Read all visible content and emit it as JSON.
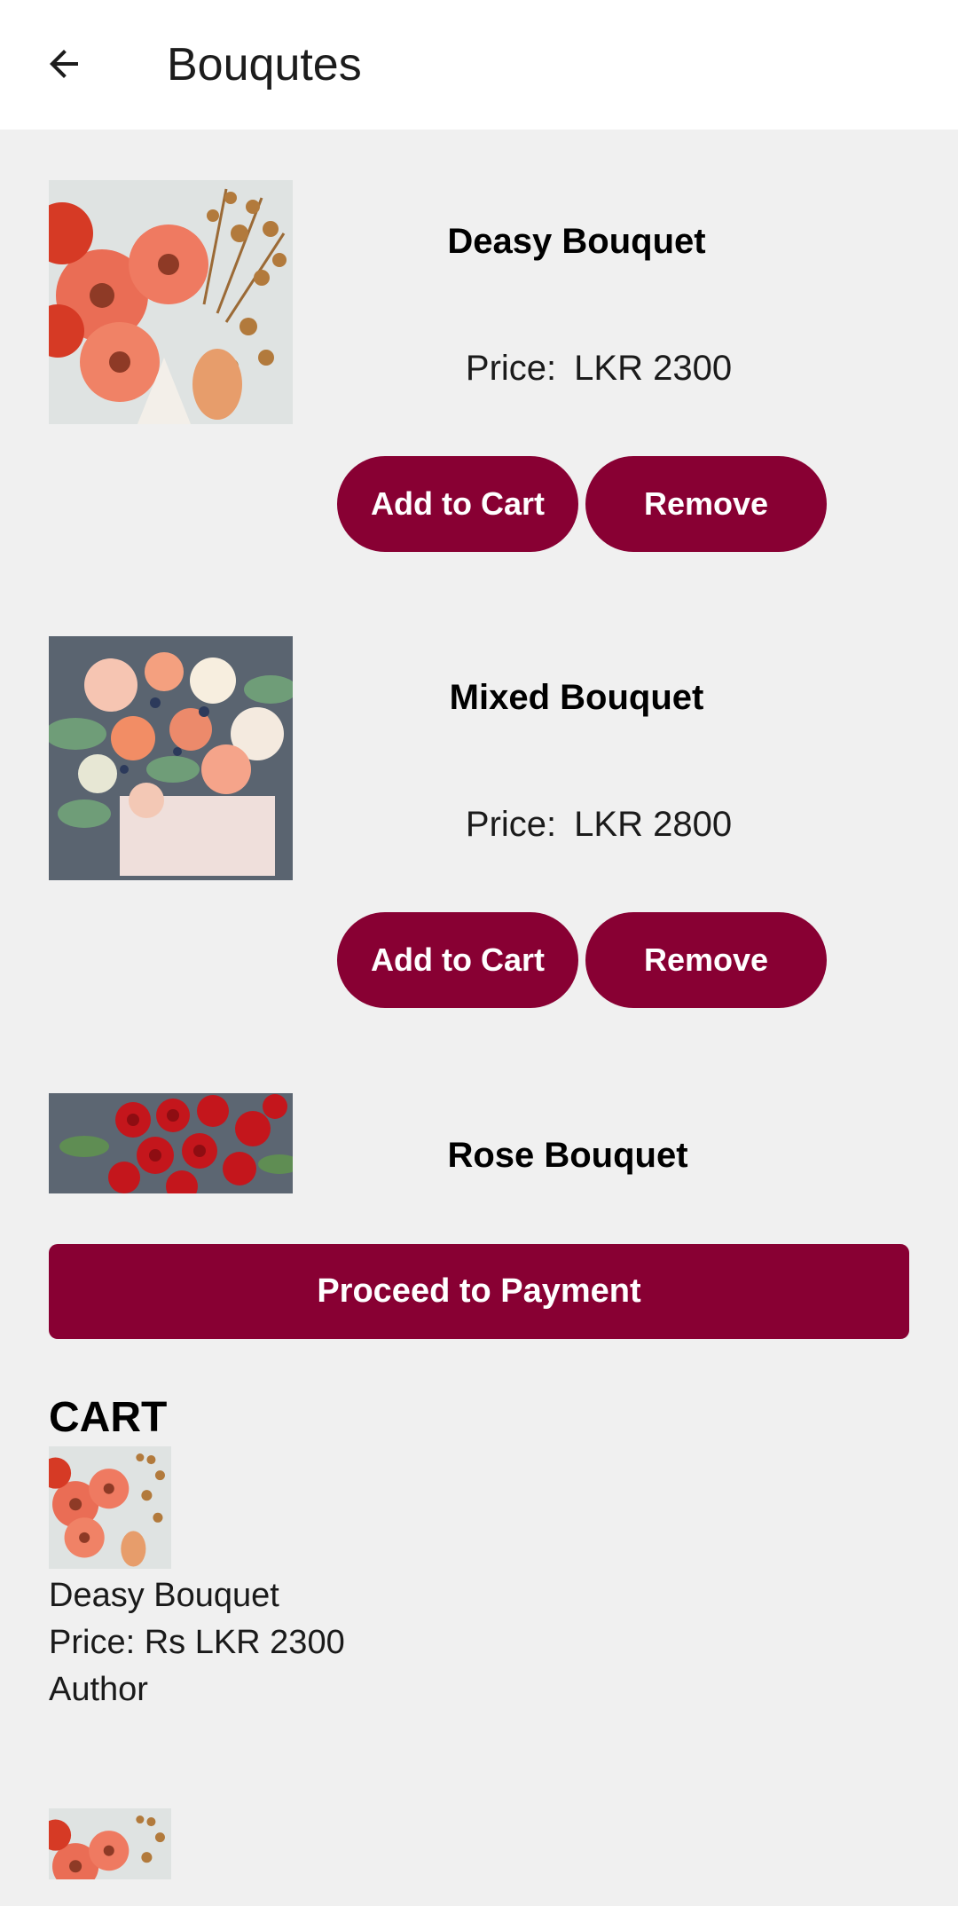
{
  "appbar": {
    "title": "Bouqutes",
    "back_icon": "arrow-left-icon"
  },
  "products": [
    {
      "name": "Deasy Bouquet",
      "price_label": "Price:",
      "price": "LKR 2300",
      "add_label": "Add to Cart",
      "remove_label": "Remove",
      "image": "zinnia-bouquet"
    },
    {
      "name": "Mixed Bouquet",
      "price_label": "Price:",
      "price": "LKR 2800",
      "add_label": "Add to Cart",
      "remove_label": "Remove",
      "image": "mixed-flower-box"
    },
    {
      "name": "Rose Bouquet",
      "image": "red-roses"
    }
  ],
  "proceed_label": "Proceed to Payment",
  "cart": {
    "heading": "CART",
    "items": [
      {
        "name": "Deasy Bouquet",
        "price": "Price: Rs LKR 2300",
        "author": "Author",
        "image": "zinnia-bouquet"
      },
      {
        "image": "zinnia-bouquet"
      }
    ]
  },
  "colors": {
    "accent": "#880033",
    "background": "#f0f0f0",
    "appbar": "#ffffff"
  }
}
